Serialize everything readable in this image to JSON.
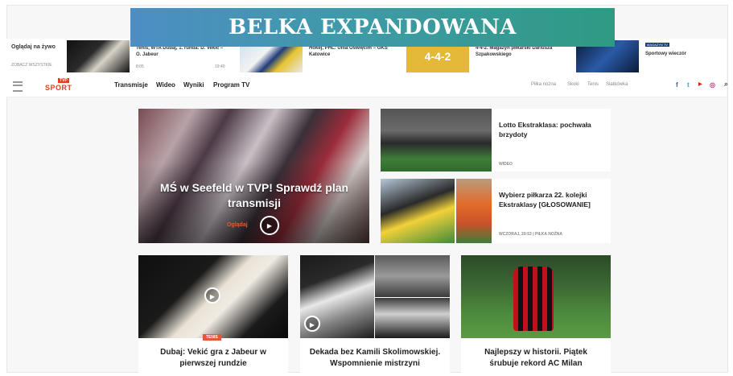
{
  "banner": {
    "title": "BELKA EXPANDOWANA"
  },
  "ticker": {
    "live_label": "Oglądaj na żywo",
    "live_sub": "ZOBACZ WSZYSTKIE",
    "items": [
      {
        "text": "Tenis, WTA Dubaj, 1. runda: D. Vekić – O. Jabeur",
        "time_left": "8:05",
        "time_right": "19:40"
      },
      {
        "text": "Hokej, PHL: Unia Oświęcim – GKS Katowice"
      },
      {
        "text": "4-4-2. Magazyn piłkarski Dariusza Szpakowskiego"
      },
      {
        "text": "Sportowy wieczór",
        "badge": "MAGAZYN TV"
      }
    ]
  },
  "nav": {
    "logo_top": "TVP",
    "logo_word": "SPORT",
    "items": [
      "Transmisje",
      "Wideo",
      "Wyniki",
      "Program TV"
    ],
    "right_items": [
      "Piłka nożna",
      "Skoki",
      "Tenis",
      "Siatkówka"
    ],
    "social": [
      "f",
      "t",
      "▶",
      "◎"
    ]
  },
  "hero": {
    "title": "MŚ w Seefeld w TVP! Sprawdź plan transmisji",
    "sub": "Oglądaj"
  },
  "side": [
    {
      "title": "Lotto Ekstraklasa: pochwała brzydoty",
      "meta": "WIDEO"
    },
    {
      "title": "Wybierz piłkarza 22. kolejki Ekstraklasy [GŁOSOWANIE]",
      "meta": "WCZORAJ, 20:53 | PIŁKA NOŻNA"
    }
  ],
  "bottom": [
    {
      "title": "Dubaj: Vekić gra z Jabeur w pierwszej rundzie",
      "tag": "TENIS"
    },
    {
      "title": "Dekada bez Kamili Skolimowskiej. Wspomnienie mistrzyni"
    },
    {
      "title": "Najlepszy w historii. Piątek śrubuje rekord AC Milan"
    }
  ]
}
